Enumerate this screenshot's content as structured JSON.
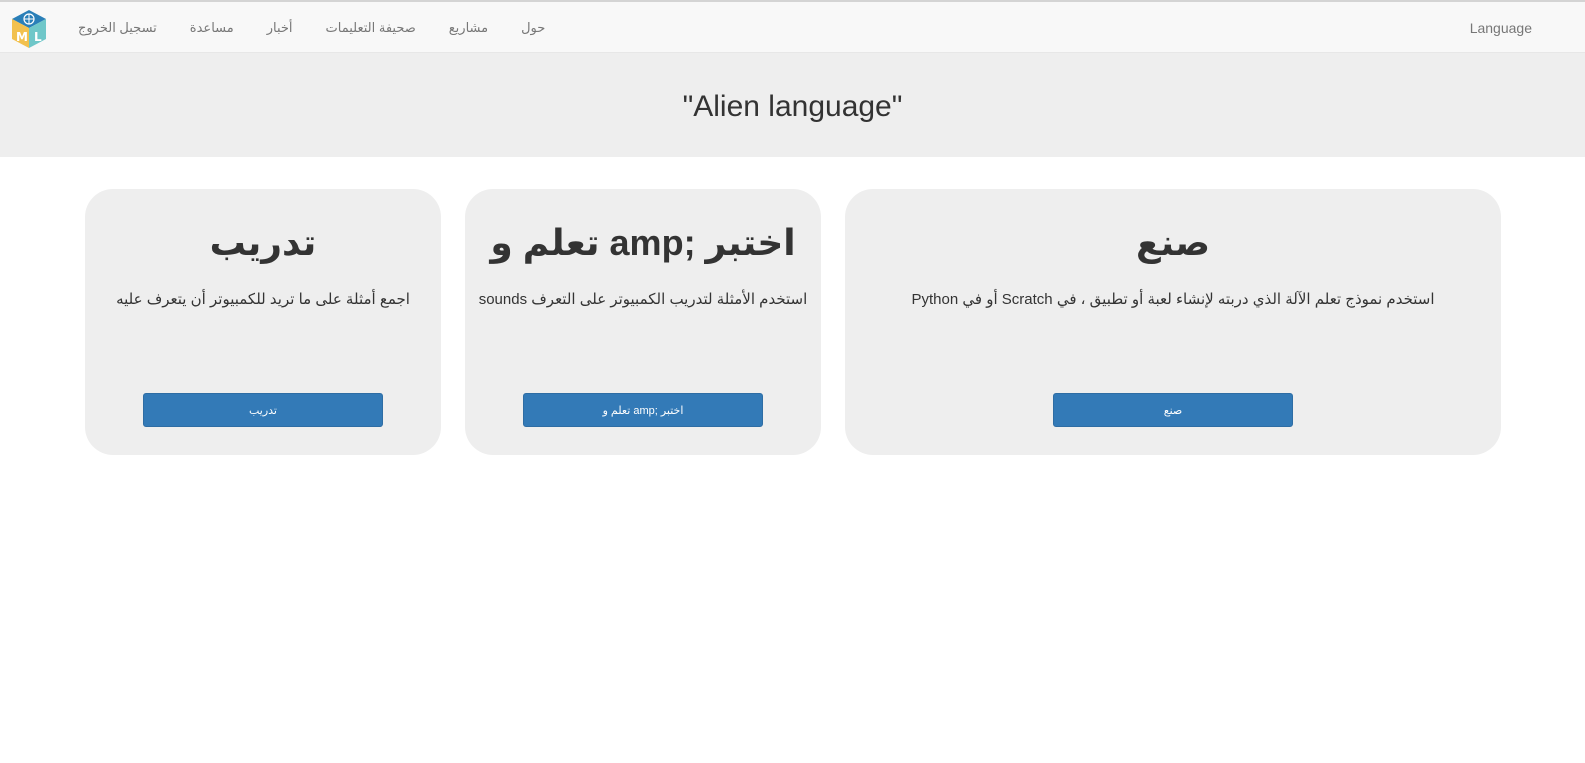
{
  "nav": {
    "links": [
      "حول",
      "مشاريع",
      "صحيفة التعليمات",
      "أخبار",
      "مساعدة",
      "تسجيل الخروج"
    ],
    "language": "Language"
  },
  "header": {
    "title": "\"Alien language\""
  },
  "cards": {
    "make": {
      "title": "صنع",
      "description": "Python أو في Scratch استخدم نموذج تعلم الآلة الذي دربته لإنشاء لعبة أو تطبيق ، في",
      "button": "صنع"
    },
    "test": {
      "title": "اختبر ;amp تعلم و",
      "description": "sounds استخدم الأمثلة لتدريب الكمبيوتر على التعرف",
      "button": "اختبر ;amp تعلم و"
    },
    "train": {
      "title": "تدريب",
      "description": "اجمع أمثلة على ما تريد للكمبيوتر أن يتعرف عليه",
      "button": "تدريب"
    }
  },
  "colors": {
    "primary_button": "#337ab7",
    "card_bg": "#eeeeee",
    "navbar_bg": "#f8f8f8"
  },
  "icons": {
    "logo": "ml-cube-logo"
  }
}
